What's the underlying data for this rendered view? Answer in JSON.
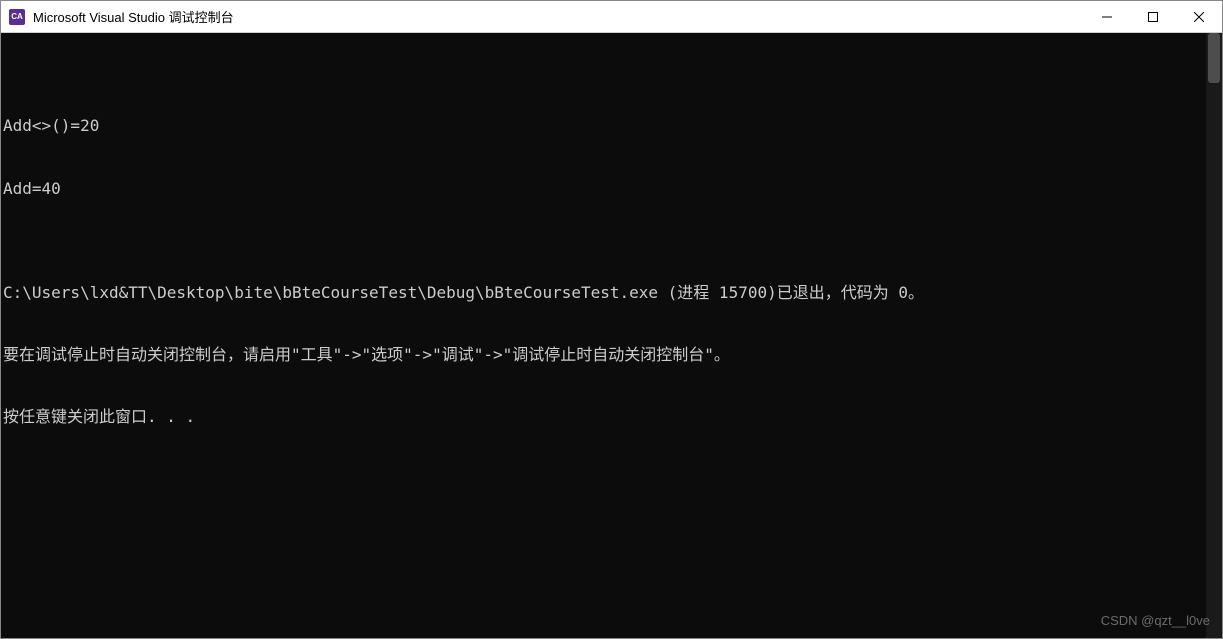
{
  "titlebar": {
    "icon_label": "CA",
    "title": "Microsoft Visual Studio 调试控制台"
  },
  "console": {
    "lines": [
      "Add<>()=20",
      "Add=40",
      "",
      "C:\\Users\\lxd&TT\\Desktop\\bite\\bBteCourseTest\\Debug\\bBteCourseTest.exe (进程 15700)已退出，代码为 0。",
      "要在调试停止时自动关闭控制台，请启用\"工具\"->\"选项\"->\"调试\"->\"调试停止时自动关闭控制台\"。",
      "按任意键关闭此窗口. . ."
    ]
  },
  "watermark": "CSDN @qzt__l0ve"
}
